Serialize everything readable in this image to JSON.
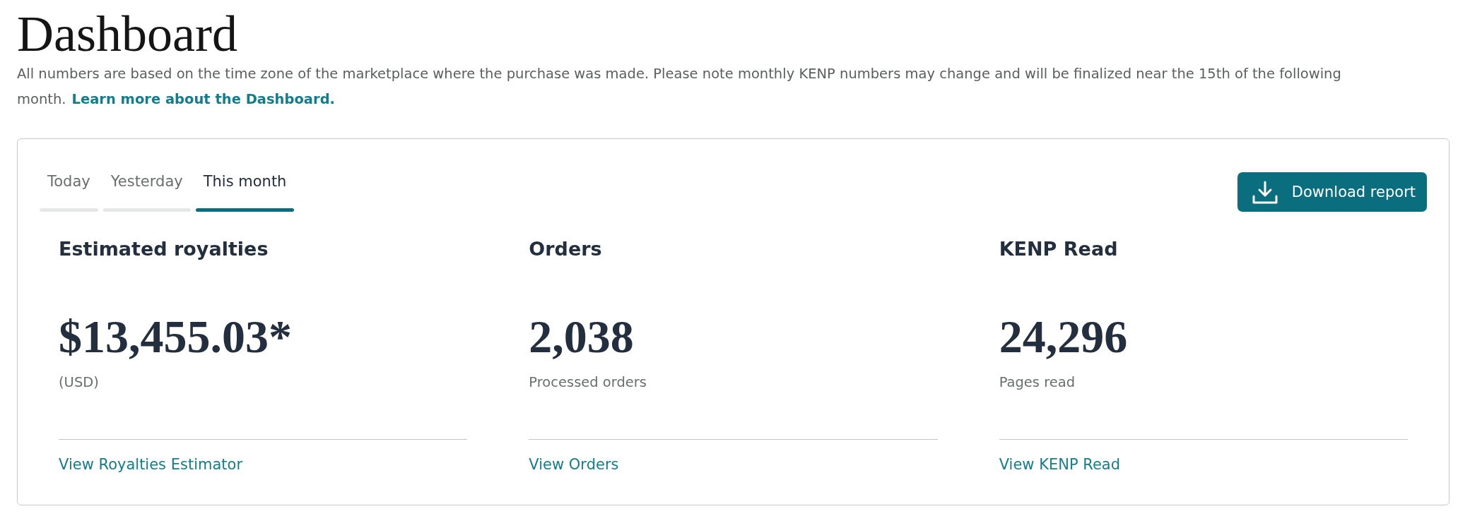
{
  "page": {
    "title": "Dashboard",
    "description": "All numbers are based on the time zone of the marketplace where the purchase was made. Please note monthly KENP numbers may change and will be finalized near the 15th of the following month.",
    "link": "Learn more about the Dashboard."
  },
  "tabs": [
    {
      "label": "Today",
      "selected": false
    },
    {
      "label": "Yesterday",
      "selected": false
    },
    {
      "label": "This month",
      "selected": true
    }
  ],
  "download_button": {
    "label": "Download report"
  },
  "metrics": [
    {
      "title": "Estimated royalties",
      "value": "$13,455.03*",
      "caption": "(USD)",
      "link": "View Royalties Estimator"
    },
    {
      "title": "Orders",
      "value": "2,038",
      "caption": "Processed orders",
      "link": "View Orders"
    },
    {
      "title": "KENP Read",
      "value": "24,296",
      "caption": "Pages read",
      "link": "View KENP Read"
    }
  ]
}
